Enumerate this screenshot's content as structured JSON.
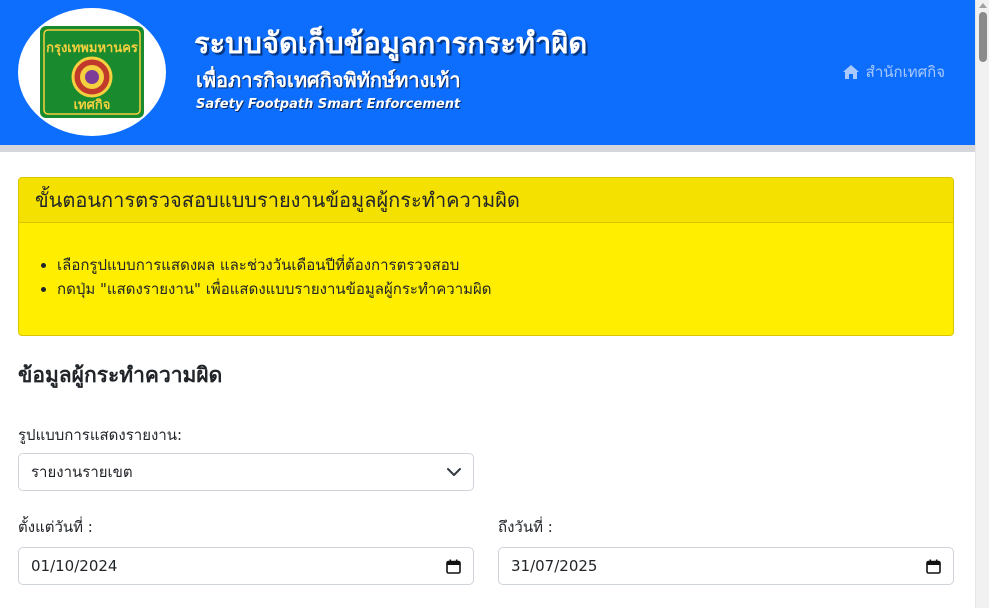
{
  "header": {
    "title": "ระบบจัดเก็บข้อมูลการกระทำผิด",
    "subtitle": "เพื่อภารกิจเทศกิจพิทักษ์ทางเท้า",
    "subtitle_en": "Safety Footpath Smart Enforcement",
    "nav_label": "สำนักเทศกิจ",
    "nav_icon": "home-icon"
  },
  "logo": {
    "icon": "bangkok-tesakij-seal-icon",
    "text_top": "กรุงเทพมหานคร",
    "text_bottom": "เทศกิจ"
  },
  "alert": {
    "title": "ขั้นตอนการตรวจสอบแบบรายงานข้อมูลผู้กระทำความผิด",
    "items": [
      "เลือกรูปแบบการแสดงผล และช่วงวันเดือนปีที่ต้องการตรวจสอบ",
      "กดปุ่ม \"แสดงรายงาน\" เพื่อแสดงแบบรายงานข้อมูลผู้กระทำความผิด"
    ]
  },
  "form": {
    "section_title": "ข้อมูลผู้กระทำความผิด",
    "report_type_label": "รูปแบบการแสดงรายงาน:",
    "report_type_value": "รายงานรายเขต",
    "from_label": "ตั้งแต่วันที่ :",
    "from_value": "01/10/2024",
    "to_label": "ถึงวันที่ :",
    "to_value": "31/07/2025"
  },
  "colors": {
    "header_bg": "#0d6efd",
    "alert_bg": "#ffee00",
    "nav_link": "#a9c8fb"
  }
}
